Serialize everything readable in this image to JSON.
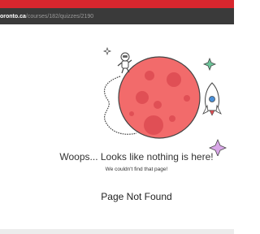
{
  "browser": {
    "url_host": "oronto.ca",
    "url_path": "/courses/182/quizzes/2190"
  },
  "page": {
    "headline": "Woops... Looks like nothing is here!",
    "subtext": "We couldn't find that page!",
    "error_title": "Page Not Found"
  },
  "illustration": {
    "icons": [
      "astronaut-icon",
      "planet-icon",
      "rocket-icon",
      "sparkle-icon"
    ]
  },
  "colors": {
    "brand_red": "#d8262e",
    "planet": "#f26b6b",
    "crater": "#e04f55",
    "sparkle_green": "#6dc59a",
    "sparkle_purple": "#d9a7e8"
  }
}
